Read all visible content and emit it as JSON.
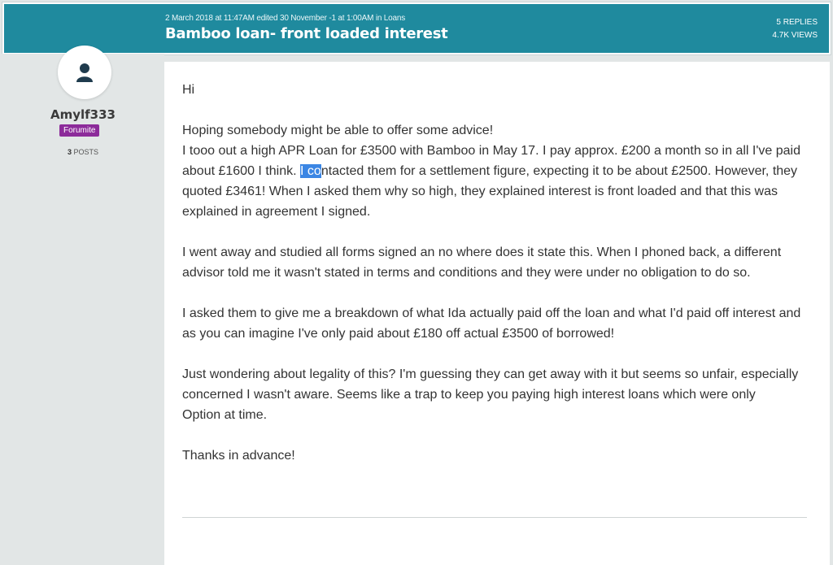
{
  "thread": {
    "meta_date": "2 March 2018 at 11:47AM",
    "meta_edited": "edited 30 November -1 at 1:00AM",
    "meta_in": "in",
    "meta_category": "Loans",
    "title": "Bamboo loan- front loaded interest",
    "replies": "5 REPLIES",
    "views": "4.7K VIEWS"
  },
  "author": {
    "icon": "user-icon",
    "name": "Amylf333",
    "rank": "Forumite",
    "posts_count": "3",
    "posts_label": "POSTS"
  },
  "post": {
    "p1": "Hi",
    "p2_l1": "Hoping somebody might be able to offer some advice!",
    "p2_l2": "I tooo out a high APR Loan for £3500 with Bamboo in May 17. I pay approx. £200 a month so in all I've paid about £1600 I think.",
    "p2_sel": "I co",
    "p2_l3": "ntacted them for a settlement figure, expecting it to be about £2500. However, they quoted £3461! When I asked them why so high, they explained interest is front loaded and that this was explained in agreement I signed.",
    "p3": "I went away and studied all forms signed an no where does it state this. When I phoned back, a different advisor told me it wasn't stated in terms and conditions and they were under no obligation to do so.",
    "p4": "I asked them to give me a breakdown of what Ida actually paid off the loan and what I'd paid off interest and as you can imagine I've only paid about £180 off actual £3500 of borrowed!",
    "p5_l1": "Just wondering about legality of this? I'm guessing they can get away with it but seems so unfair, especially concerned I wasn't aware. Seems like a trap to keep you paying high interest loans which were only",
    "p5_l2": "Option at time.",
    "p6": "Thanks in advance!"
  },
  "colors": {
    "header_bg": "#1f8a9e",
    "rank_badge": "#8c2b9a",
    "selection": "#3b86e4"
  }
}
